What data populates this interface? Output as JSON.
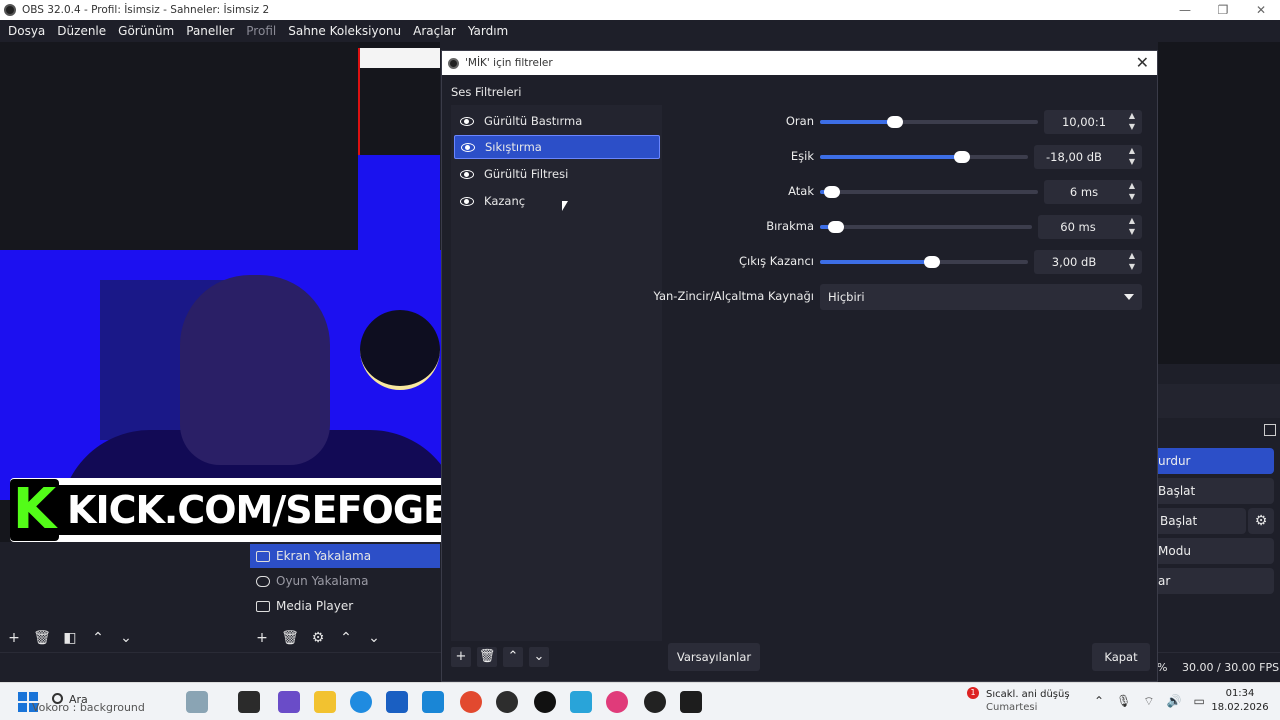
{
  "window": {
    "title": "OBS 32.0.4 - Profil: İsimsiz - Sahneler: İsimsiz 2",
    "controls": [
      "—",
      "❐",
      "✕"
    ]
  },
  "menu": [
    {
      "label": "Dosya",
      "enabled": true
    },
    {
      "label": "Düzenle",
      "enabled": true
    },
    {
      "label": "Görünüm",
      "enabled": true
    },
    {
      "label": "Paneller",
      "enabled": true
    },
    {
      "label": "Profil",
      "enabled": false
    },
    {
      "label": "Sahne Koleksiyonu",
      "enabled": true
    },
    {
      "label": "Araçlar",
      "enabled": true
    },
    {
      "label": "Yardım",
      "enabled": true
    }
  ],
  "banner": {
    "logo": "K",
    "text": "KICK.COM/SEFOGE"
  },
  "sources": [
    {
      "label": "Ekran Yakalama",
      "icon": "monitor-icon",
      "selected": true
    },
    {
      "label": "Oyun Yakalama",
      "icon": "gamepad-icon",
      "selected": false
    },
    {
      "label": "Media Player",
      "icon": "media-icon",
      "selected": false
    }
  ],
  "controls": {
    "buttons": [
      "urdur",
      "Başlat",
      "Başlat",
      "Modu",
      "ar"
    ],
    "gear": "⚙"
  },
  "status": {
    "pct": "%",
    "fps": "30.00 / 30.00 FPS"
  },
  "dialog": {
    "title": "'MİK' için filtreler",
    "close": "✕",
    "section": "Ses Filtreleri",
    "filters": [
      {
        "label": "Gürültü Bastırma",
        "selected": false
      },
      {
        "label": "Sıkıştırma",
        "selected": true
      },
      {
        "label": "Gürültü Filtresi",
        "selected": false
      },
      {
        "label": "Kazanç",
        "selected": false
      }
    ],
    "properties": [
      {
        "label": "Oran",
        "value": "10,00:1",
        "level": 0.33
      },
      {
        "label": "Eşik",
        "value": "-18,00 dB",
        "level": 0.7
      },
      {
        "label": "Atak",
        "value": "6 ms",
        "level": 0.02
      },
      {
        "label": "Bırakma",
        "value": "60 ms",
        "level": 0.04
      },
      {
        "label": "Çıkış Kazancı",
        "value": "3,00 dB",
        "level": 0.54
      }
    ],
    "sidechain": {
      "label": "Yan-Zincir/Alçaltma Kaynağı",
      "value": "Hiçbiri"
    },
    "defaults_label": "Varsayılanlar",
    "close_label": "Kapat"
  },
  "taskbar": {
    "search": "Ara",
    "overlay": "Vokoro : background",
    "notification": {
      "count": "1",
      "line1": "Sıcakl. ani düşüş",
      "line2": "Cumartesi"
    },
    "time": "01:34",
    "date": "18.02.2026"
  },
  "colors": {
    "accent": "#2c4fc8",
    "slider": "#3d6ee6",
    "kick_green": "#53fc18"
  }
}
